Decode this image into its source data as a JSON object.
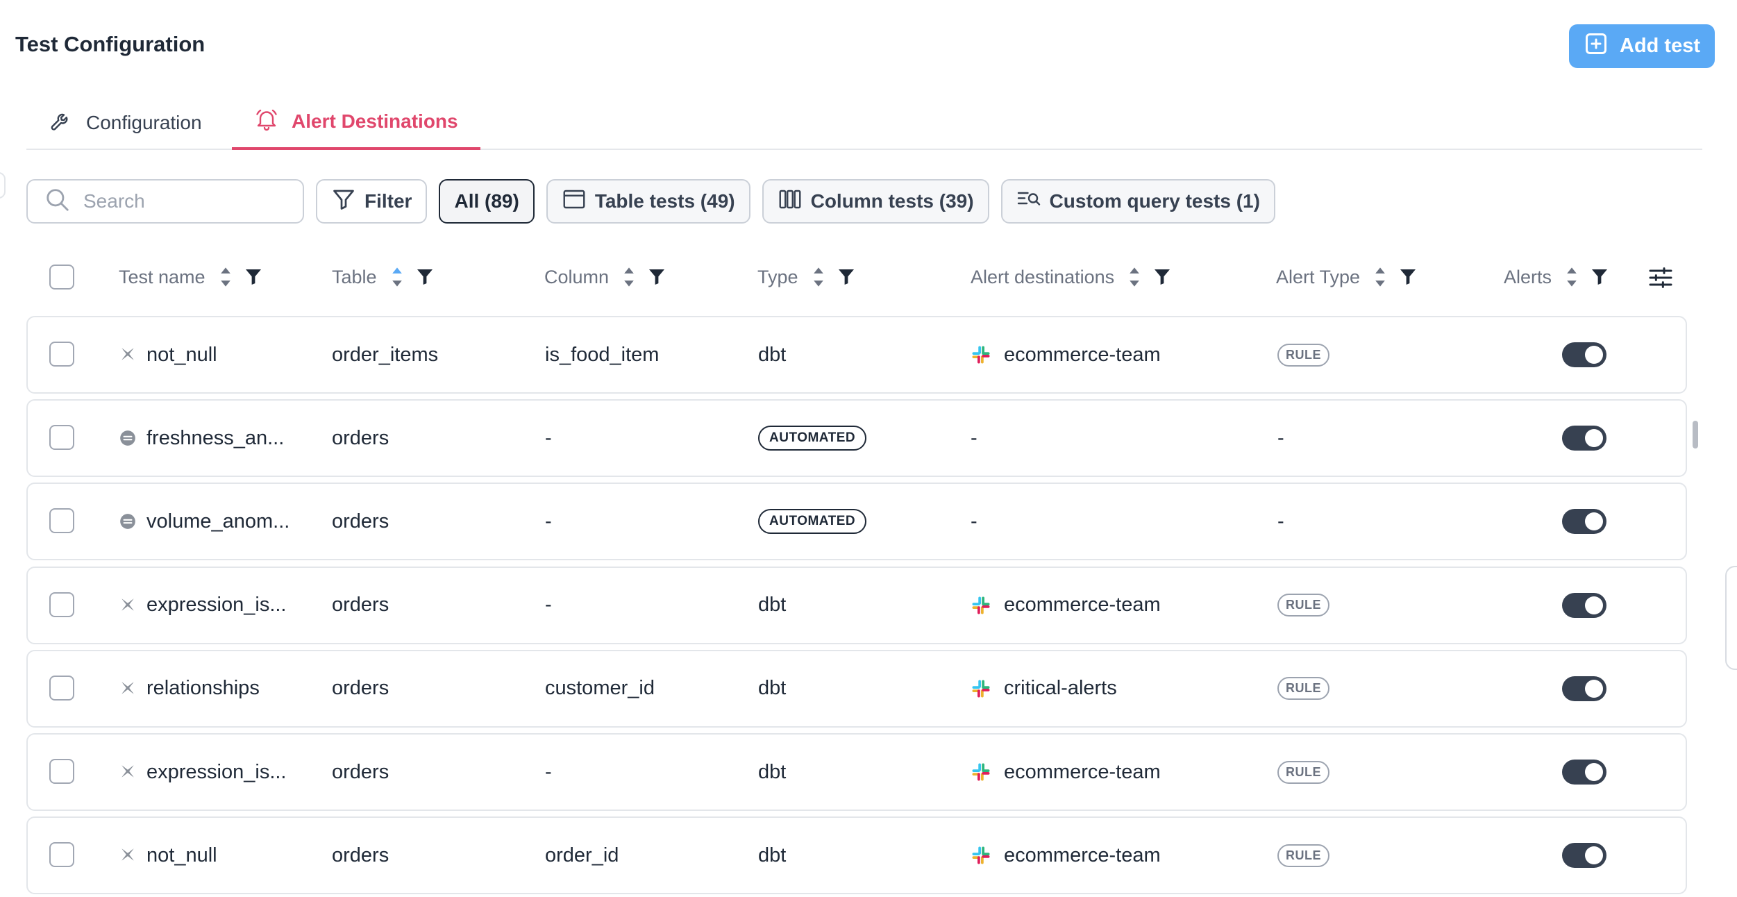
{
  "page": {
    "title": "Test Configuration"
  },
  "actions": {
    "add_test_label": "Add test"
  },
  "tabs": [
    {
      "label": "Configuration",
      "icon": "wrench-icon",
      "active": false
    },
    {
      "label": "Alert Destinations",
      "icon": "bell-icon",
      "active": true
    }
  ],
  "toolbar": {
    "search_placeholder": "Search",
    "filter_label": "Filter",
    "chips": [
      {
        "label": "All (89)",
        "icon": "",
        "active": true
      },
      {
        "label": "Table tests (49)",
        "icon": "table-icon",
        "active": false
      },
      {
        "label": "Column tests (39)",
        "icon": "columns-icon",
        "active": false
      },
      {
        "label": "Custom query tests (1)",
        "icon": "query-search-icon",
        "active": false
      }
    ]
  },
  "table": {
    "columns": [
      "Test name",
      "Table",
      "Column",
      "Type",
      "Alert destinations",
      "Alert Type",
      "Alerts"
    ],
    "rows": [
      {
        "test_name": "not_null",
        "test_icon": "dbt-icon",
        "table": "order_items",
        "column": "is_food_item",
        "type": "dbt",
        "type_badge": false,
        "destination": "ecommerce-team",
        "dest_icon": "slack-icon",
        "alert_type": "RULE",
        "alerts_on": true
      },
      {
        "test_name": "freshness_an...",
        "test_icon": "automated-icon",
        "table": "orders",
        "column": "-",
        "type": "AUTOMATED",
        "type_badge": true,
        "destination": "-",
        "dest_icon": "",
        "alert_type": "-",
        "alerts_on": true
      },
      {
        "test_name": "volume_anom...",
        "test_icon": "automated-icon",
        "table": "orders",
        "column": "-",
        "type": "AUTOMATED",
        "type_badge": true,
        "destination": "-",
        "dest_icon": "",
        "alert_type": "-",
        "alerts_on": true
      },
      {
        "test_name": "expression_is...",
        "test_icon": "dbt-icon",
        "table": "orders",
        "column": "-",
        "type": "dbt",
        "type_badge": false,
        "destination": "ecommerce-team",
        "dest_icon": "slack-icon",
        "alert_type": "RULE",
        "alerts_on": true
      },
      {
        "test_name": "relationships",
        "test_icon": "dbt-icon",
        "table": "orders",
        "column": "customer_id",
        "type": "dbt",
        "type_badge": false,
        "destination": "critical-alerts",
        "dest_icon": "slack-icon",
        "alert_type": "RULE",
        "alerts_on": true
      },
      {
        "test_name": "expression_is...",
        "test_icon": "dbt-icon",
        "table": "orders",
        "column": "-",
        "type": "dbt",
        "type_badge": false,
        "destination": "ecommerce-team",
        "dest_icon": "slack-icon",
        "alert_type": "RULE",
        "alerts_on": true
      },
      {
        "test_name": "not_null",
        "test_icon": "dbt-icon",
        "table": "orders",
        "column": "order_id",
        "type": "dbt",
        "type_badge": false,
        "destination": "ecommerce-team",
        "dest_icon": "slack-icon",
        "alert_type": "RULE",
        "alerts_on": true
      }
    ]
  },
  "colors": {
    "primary": "#5aa9f5",
    "accent": "#e0476c",
    "toggle_on": "#374151",
    "text": "#1f2937",
    "muted": "#6b7280",
    "border": "#e3e6ea"
  }
}
